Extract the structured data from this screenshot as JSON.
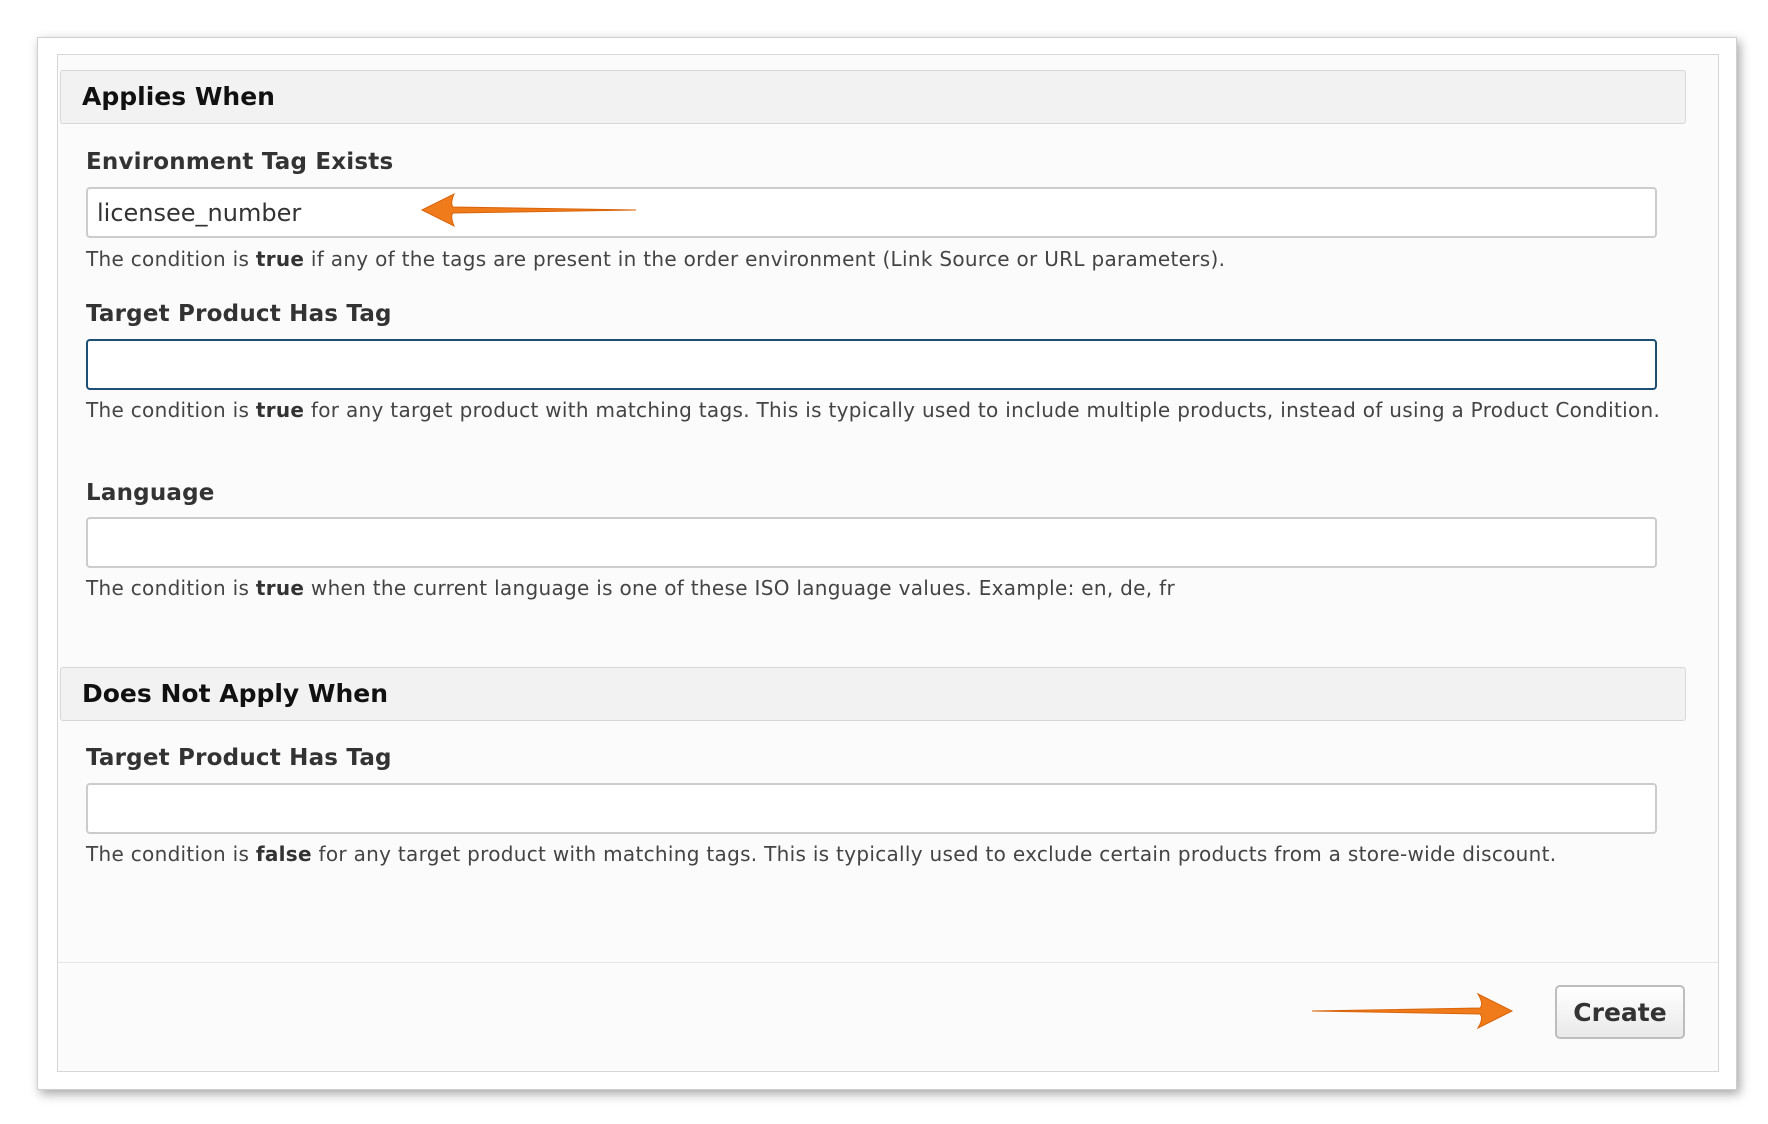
{
  "applies_when": {
    "header": "Applies When",
    "environment_tag": {
      "label": "Environment Tag Exists",
      "value": "licensee_number",
      "help_pre": "The condition is ",
      "help_bold": "true",
      "help_post": " if any of the tags are present in the order environment (Link Source or URL parameters)."
    },
    "target_product_tag": {
      "label": "Target Product Has Tag",
      "value": "",
      "help_pre": "The condition is ",
      "help_bold": "true",
      "help_post": " for any target product with matching tags. This is typically used to include multiple products, instead of using a Product Condition."
    },
    "language": {
      "label": "Language",
      "value": "",
      "help_pre": "The condition is ",
      "help_bold": "true",
      "help_post": " when the current language is one of these ISO language values. Example: en, de, fr"
    }
  },
  "does_not_apply_when": {
    "header": "Does Not Apply When",
    "target_product_tag": {
      "label": "Target Product Has Tag",
      "value": "",
      "help_pre": "The condition is ",
      "help_bold": "false",
      "help_post": " for any target product with matching tags. This is typically used to exclude certain products from a store-wide discount."
    }
  },
  "footer": {
    "create_label": "Create"
  },
  "colors": {
    "annotation_arrow": "#f07b1a",
    "focused_border": "#1c4f73"
  }
}
